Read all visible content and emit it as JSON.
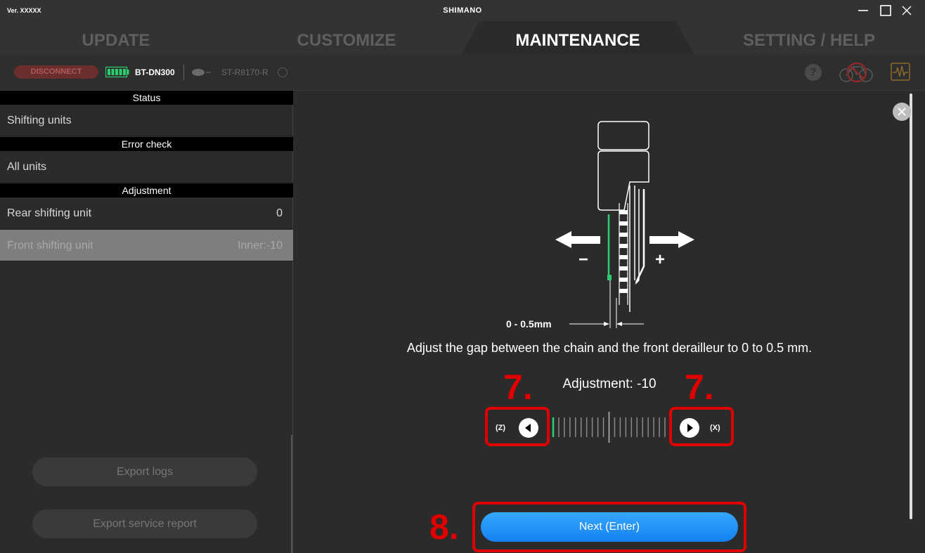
{
  "titlebar": {
    "version": "Ver. XXXXX",
    "brand": "SHIMANO",
    "icons": [
      "minimize-icon",
      "maximize-icon",
      "close-icon"
    ]
  },
  "tabs": [
    {
      "label": "UPDATE",
      "active": false
    },
    {
      "label": "CUSTOMIZE",
      "active": false
    },
    {
      "label": "MAINTENANCE",
      "active": true
    },
    {
      "label": "SETTING / HELP",
      "active": false
    }
  ],
  "devicebar": {
    "disconnect_label": "DISCONNECT",
    "device1": "BT-DN300",
    "device2": "ST-R8170-R",
    "help_label": "?",
    "icons": [
      "battery-icon",
      "shifter-icon",
      "help-icon",
      "no-bike-icon",
      "waveform-icon"
    ]
  },
  "sidebar": {
    "sections": [
      {
        "header": "Status",
        "items": [
          {
            "label": "Shifting units",
            "value": ""
          }
        ]
      },
      {
        "header": "Error check",
        "items": [
          {
            "label": "All units",
            "value": ""
          }
        ]
      },
      {
        "header": "Adjustment",
        "items": [
          {
            "label": "Rear shifting unit",
            "value": "0"
          },
          {
            "label": "Front shifting unit",
            "value": "Inner:-10",
            "selected": true
          }
        ]
      }
    ],
    "export_logs": "Export logs",
    "export_report": "Export service report"
  },
  "main": {
    "diagram": {
      "minus": "−",
      "plus": "+",
      "gap": "0 - 0.5mm"
    },
    "instruction": "Adjust the gap between the chain and the front derailleur to 0 to 0.5 mm.",
    "adjustment_label": "Adjustment: -10",
    "left_key": "(Z)",
    "right_key": "(X)",
    "adjustment_value": -10,
    "adjustment_range": [
      -10,
      10
    ],
    "next_button": "Next (Enter)",
    "annotations": {
      "step_7": "7.",
      "step_8": "8."
    }
  },
  "colors": {
    "accent_blue": "#1f8ff5",
    "indicator_green": "#2ecc71",
    "annotation_red": "#e00000"
  }
}
